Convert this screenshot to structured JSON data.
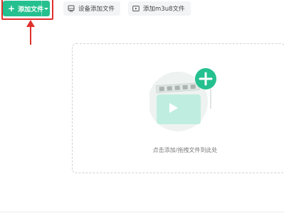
{
  "toolbar": {
    "add_file_label": "添加文件",
    "device_add_label": "设备添加文件",
    "add_m3u8_label": "添加m3u8文件"
  },
  "dropzone": {
    "hint": "点击添加/拖拽文件到此处"
  },
  "icons": {
    "add": "plus-icon",
    "dropdown": "chevron-down-icon",
    "device": "device-icon",
    "m3u8": "video-icon",
    "illustration": "video-add-illustration"
  },
  "colors": {
    "accent": "#25c08f",
    "annotation": "#e0302c"
  }
}
